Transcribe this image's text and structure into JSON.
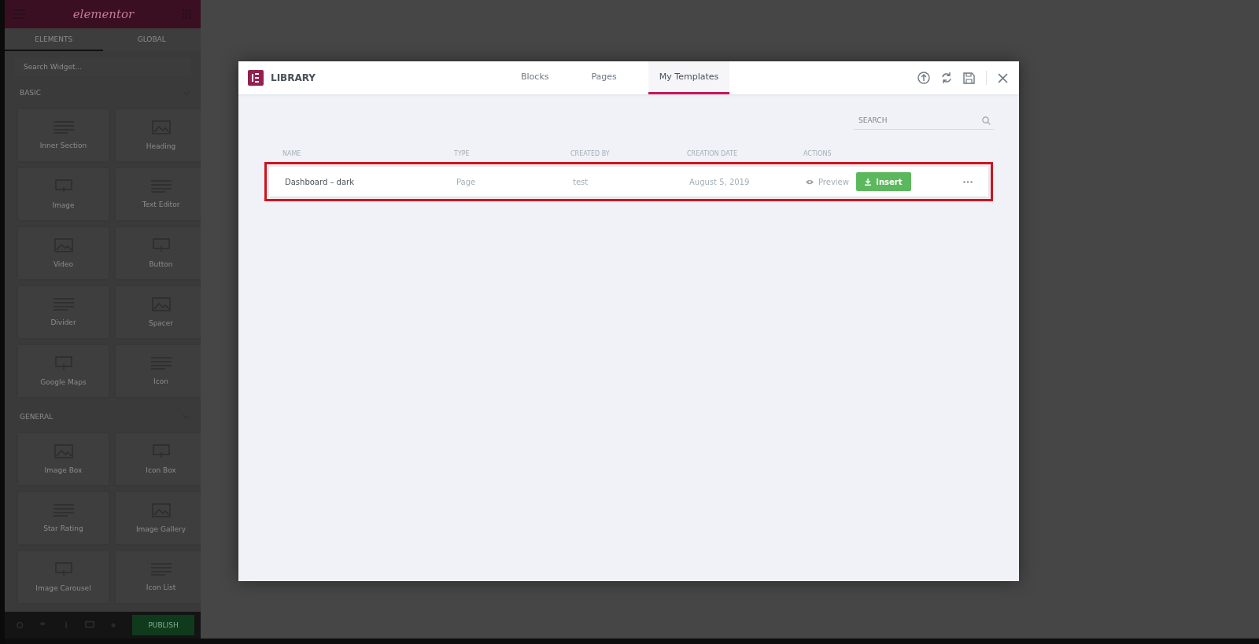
{
  "sidebar": {
    "logo": "elementor",
    "tabs": [
      {
        "label": "ELEMENTS",
        "selected": true
      },
      {
        "label": "GLOBAL",
        "selected": false
      }
    ],
    "search": {
      "placeholder": "Search Widget..."
    },
    "sections": [
      {
        "title": "BASIC",
        "expanded": true,
        "widgets": [
          "Inner Section",
          "Heading",
          "Image",
          "Text Editor",
          "Video",
          "Button",
          "Divider",
          "Spacer",
          "Google Maps",
          "Icon"
        ]
      },
      {
        "title": "GENERAL",
        "expanded": true,
        "widgets": [
          "Image Box",
          "Icon Box",
          "Star Rating",
          "Image Gallery",
          "Image Carousel",
          "Icon List"
        ]
      }
    ],
    "footer": {
      "publish": "PUBLISH"
    }
  },
  "library": {
    "title": "LIBRARY",
    "tabs": [
      {
        "label": "Blocks",
        "selected": false
      },
      {
        "label": "Pages",
        "selected": false
      },
      {
        "label": "My Templates",
        "selected": true
      }
    ],
    "search": {
      "placeholder": "SEARCH"
    },
    "table": {
      "columns": [
        "NAME",
        "TYPE",
        "CREATED BY",
        "CREATION DATE",
        "ACTIONS"
      ],
      "rows": [
        {
          "name": "Dashboard – dark",
          "type": "Page",
          "created_by": "test",
          "date": "August 5, 2019",
          "preview": "Preview",
          "insert": "Insert",
          "highlighted": true
        }
      ]
    }
  }
}
